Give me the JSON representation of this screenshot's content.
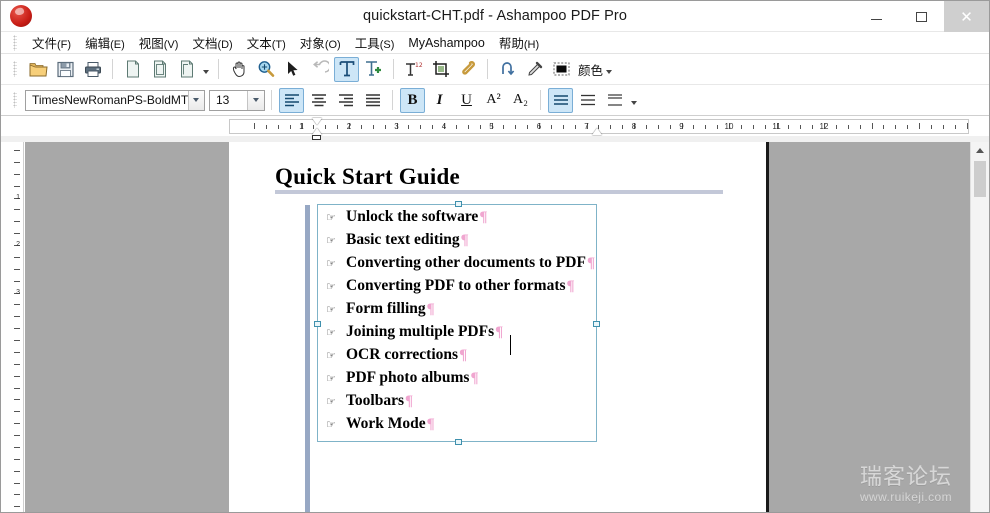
{
  "window": {
    "title": "quickstart-CHT.pdf - Ashampoo PDF Pro",
    "logo": "ashampoo-logo",
    "minimize": "—",
    "maximize": "▢",
    "close": "✕"
  },
  "menubar": {
    "items": [
      {
        "label": "文件",
        "mnemonic": "(F)",
        "name": "menu-file"
      },
      {
        "label": "编辑",
        "mnemonic": "(E)",
        "name": "menu-edit"
      },
      {
        "label": "视图",
        "mnemonic": "(V)",
        "name": "menu-view"
      },
      {
        "label": "文档",
        "mnemonic": "(D)",
        "name": "menu-document"
      },
      {
        "label": "文本",
        "mnemonic": "(T)",
        "name": "menu-text"
      },
      {
        "label": "对象",
        "mnemonic": "(O)",
        "name": "menu-object"
      },
      {
        "label": "工具",
        "mnemonic": "(S)",
        "name": "menu-tools"
      },
      {
        "label": "MyAshampoo",
        "mnemonic": "",
        "name": "menu-myashampoo"
      },
      {
        "label": "帮助",
        "mnemonic": "(H)",
        "name": "menu-help"
      }
    ]
  },
  "toolbar": {
    "color_label": "颜色",
    "buttons": [
      "open-folder-icon",
      "save-disk-icon",
      "print-icon",
      "new-page-icon",
      "copy-page-icon",
      "duplicate-page-icon",
      "hand-tool-icon",
      "zoom-tool-icon",
      "select-arrow-icon",
      "undo-icon",
      "text-tool-icon",
      "add-text-icon",
      "text-order-icon",
      "crop-icon",
      "attach-icon",
      "link-icon",
      "eyedropper-icon",
      "color-swatch-icon"
    ]
  },
  "format_bar": {
    "font_family": "TimesNewRomanPS-BoldMT",
    "font_size": "13",
    "bold": "B",
    "italic": "I",
    "underline": "U",
    "superscript": "A²",
    "subscript": "A₂"
  },
  "ruler": {
    "numbers": [
      "1",
      "2",
      "3",
      "4",
      "5",
      "6",
      "7",
      "8",
      "9",
      "10",
      "11",
      "12"
    ],
    "vertical_numbers": [
      "1",
      "2",
      "3"
    ]
  },
  "document": {
    "title": "Quick Start Guide",
    "bullet_symbol": "☞",
    "paragraph_mark": "¶",
    "items": [
      "Unlock the software",
      "Basic text editing",
      "Converting other documents to PDF",
      "Converting PDF to other formats",
      "Form filling",
      "Joining multiple PDFs",
      "OCR corrections",
      "PDF photo albums",
      "Toolbars",
      "Work Mode"
    ]
  },
  "watermark": {
    "chinese": "瑞客论坛",
    "url": "www.ruikeji.com"
  },
  "colors": {
    "accent": "#cde6f7",
    "accent_border": "#7aaed6",
    "canvas": "#a8a8a8",
    "title_rule": "#c3c8d8",
    "selection_border": "#7fb3c8",
    "paragraph_mark": "#f0a6d0"
  }
}
